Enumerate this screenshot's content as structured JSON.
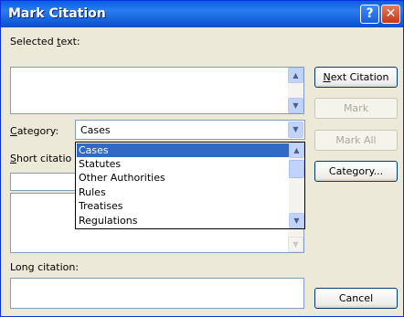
{
  "window": {
    "title": "Mark Citation",
    "help_glyph": "?",
    "close_glyph": "✕"
  },
  "labels": {
    "selected_text_pre": "Selected ",
    "selected_text_accel": "t",
    "selected_text_post": "ext:",
    "category_accel": "C",
    "category_post": "ategory:",
    "short_citation_accel": "S",
    "short_citation_post": "hort citatio",
    "long_citation": "Long citation:"
  },
  "selected_text": {
    "value": ""
  },
  "category": {
    "selected": "Cases",
    "options": [
      "Cases",
      "Statutes",
      "Other Authorities",
      "Rules",
      "Treatises",
      "Regulations"
    ],
    "highlighted_index": 0
  },
  "long_citation": {
    "value": ""
  },
  "buttons": {
    "next_citation_accel": "N",
    "next_citation_post": "ext Citation",
    "mark": "Mark",
    "mark_all": "Mark All",
    "category": "Category...",
    "cancel": "Cancel"
  },
  "icons": {
    "scroll_up": "▲",
    "scroll_down": "▼",
    "combo_arrow": "▼"
  },
  "colors": {
    "title_bar": "#0a5fe5",
    "selection": "#316ac5",
    "dialog_bg": "#ece9d8"
  }
}
